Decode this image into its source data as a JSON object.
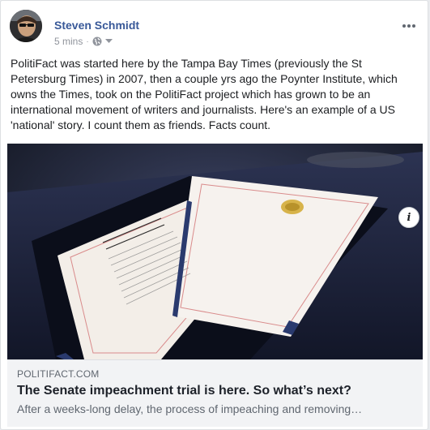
{
  "post": {
    "author": "Steven Schmidt",
    "timestamp": "5 mins",
    "separator": "·",
    "audience_icon": "globe-icon",
    "text": "PolitiFact was started here by the Tampa Bay Times (previously the St Petersburg Times) in 2007, then a couple yrs ago the Poynter Institute, which owns the Times, took on the PolitiFact project which has grown to be an international movement of writers and journalists. Here's an example of a US 'national' story. I count them as friends. Facts count."
  },
  "link_preview": {
    "domain": "POLITIFACT.COM",
    "headline": "The Senate impeachment trial is here. So what’s next?",
    "description": "After a weeks-long delay, the process of impeaching and removing…",
    "info_label": "i"
  },
  "colors": {
    "author_link": "#385898",
    "meta_gray": "#90949c",
    "caption_bg": "#f2f3f5"
  }
}
